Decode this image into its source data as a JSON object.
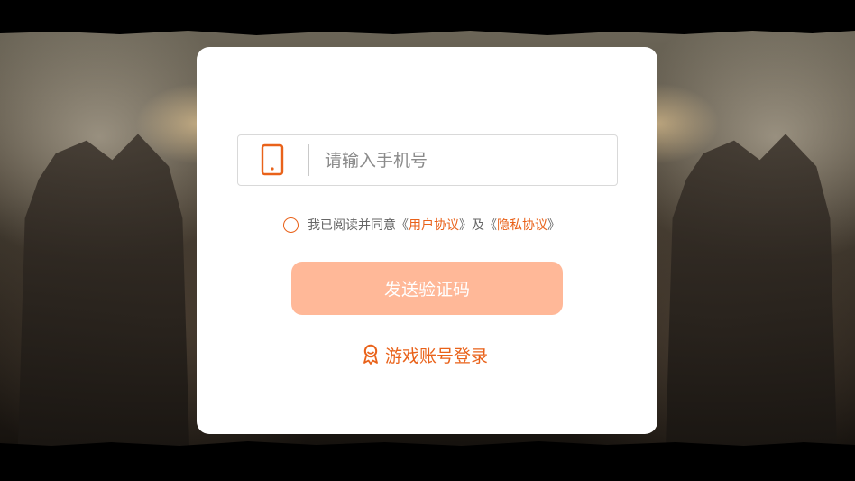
{
  "login": {
    "phone_placeholder": "请输入手机号",
    "agree_prefix": "我已阅读并同意",
    "open_bracket_1": "《",
    "user_agreement": "用户协议",
    "close_bracket_1": "》",
    "and": "及",
    "open_bracket_2": "《",
    "privacy_agreement": "隐私协议",
    "close_bracket_2": "》",
    "send_code_button": "发送验证码",
    "account_login": "游戏账号登录"
  },
  "icons": {
    "phone": "phone-icon",
    "agree_radio": "radio-circle",
    "account": "account-icon"
  },
  "colors": {
    "accent": "#e9621a",
    "button_disabled": "#ffb898",
    "dialog_bg": "#ffffff"
  }
}
